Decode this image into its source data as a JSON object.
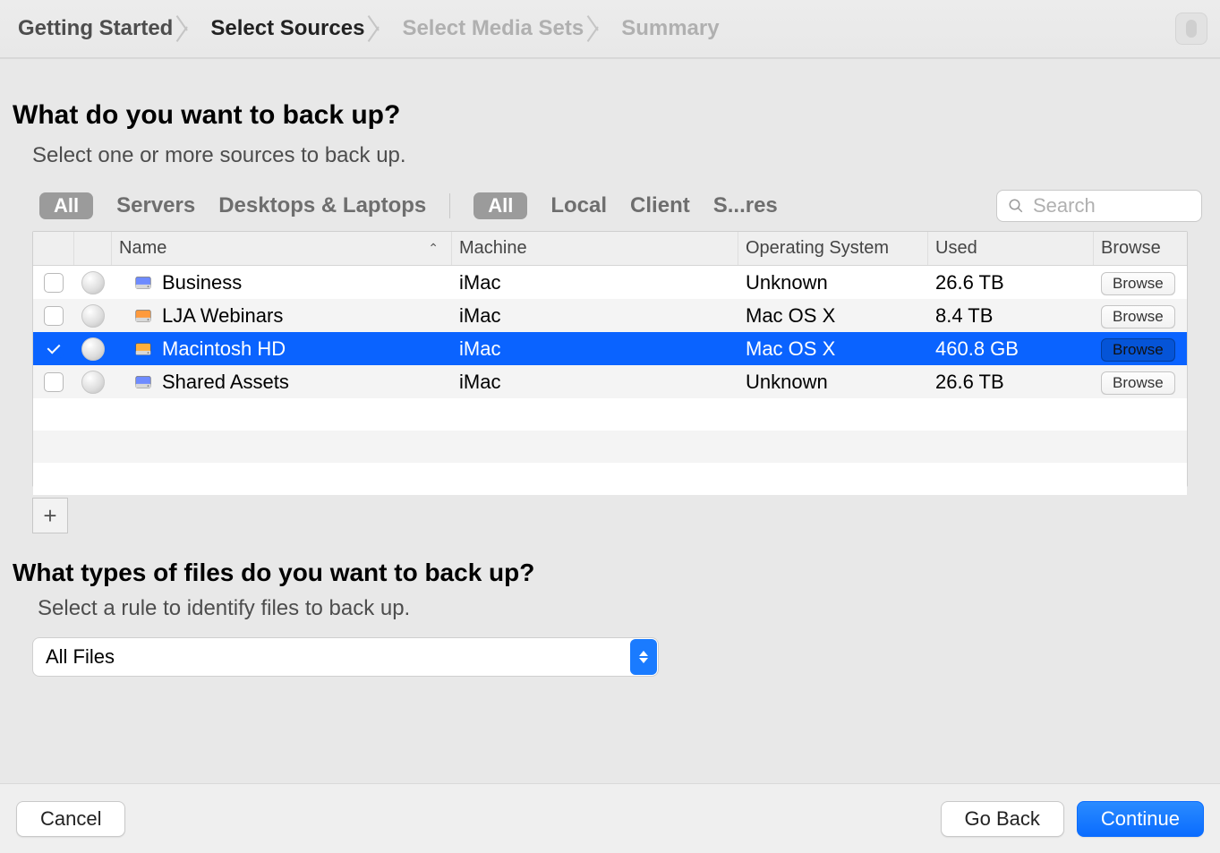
{
  "breadcrumb": {
    "steps": [
      "Getting Started",
      "Select Sources",
      "Select Media Sets",
      "Summary"
    ],
    "active_index": 1
  },
  "headings": {
    "sources_title": "What do you want to back up?",
    "sources_sub": "Select one or more sources to back up.",
    "rules_title": "What types of files do you want to back up?",
    "rules_sub": "Select a rule to identify files to back up."
  },
  "filters": {
    "group1_all": "All",
    "group1_items": [
      "Servers",
      "Desktops & Laptops"
    ],
    "group2_all": "All",
    "group2_items": [
      "Local",
      "Client",
      "S...res"
    ],
    "search_placeholder": "Search"
  },
  "table": {
    "columns": {
      "name": "Name",
      "machine": "Machine",
      "os": "Operating System",
      "used": "Used",
      "browse": "Browse"
    },
    "browse_label": "Browse",
    "rows": [
      {
        "checked": false,
        "icon": "network",
        "name": "Business",
        "machine": "iMac",
        "os": "Unknown",
        "used": "26.6 TB",
        "selected": false
      },
      {
        "checked": false,
        "icon": "external",
        "name": "LJA Webinars",
        "machine": "iMac",
        "os": "Mac OS X",
        "used": "8.4 TB",
        "selected": false
      },
      {
        "checked": true,
        "icon": "internal",
        "name": "Macintosh HD",
        "machine": "iMac",
        "os": "Mac OS X",
        "used": "460.8 GB",
        "selected": true
      },
      {
        "checked": false,
        "icon": "network",
        "name": "Shared Assets",
        "machine": "iMac",
        "os": "Unknown",
        "used": "26.6 TB",
        "selected": false
      }
    ]
  },
  "rule_select": {
    "value": "All Files"
  },
  "buttons": {
    "cancel": "Cancel",
    "go_back": "Go Back",
    "continue": "Continue",
    "add": "+"
  }
}
